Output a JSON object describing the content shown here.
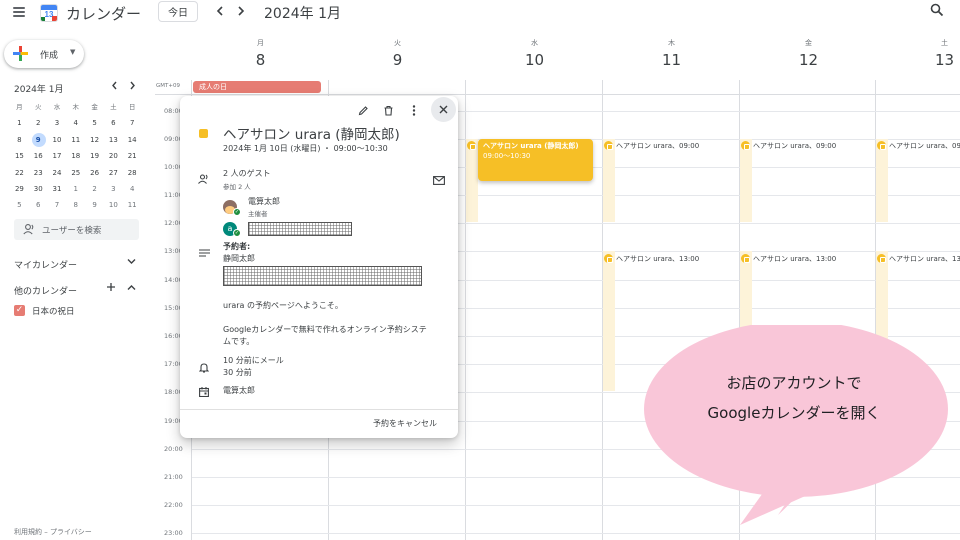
{
  "header": {
    "app_title": "カレンダー",
    "logo_number": "13",
    "today_label": "今日",
    "prev_icon": "chevron-left-icon",
    "next_icon": "chevron-right-icon",
    "month_title": "2024年 1月",
    "search_icon": "search-icon"
  },
  "sidebar": {
    "create_label": "作成",
    "mini_calendar": {
      "title": "2024年 1月",
      "weekdays": [
        "月",
        "火",
        "水",
        "木",
        "金",
        "土",
        "日"
      ],
      "weeks": [
        [
          "1",
          "2",
          "3",
          "4",
          "5",
          "6",
          "7"
        ],
        [
          "8",
          "9",
          "10",
          "11",
          "12",
          "13",
          "14"
        ],
        [
          "15",
          "16",
          "17",
          "18",
          "19",
          "20",
          "21"
        ],
        [
          "22",
          "23",
          "24",
          "25",
          "26",
          "27",
          "28"
        ],
        [
          "29",
          "30",
          "31",
          "1",
          "2",
          "3",
          "4"
        ],
        [
          "5",
          "6",
          "7",
          "8",
          "9",
          "10",
          "11"
        ]
      ],
      "selected_day": "9"
    },
    "user_search_placeholder": "ユーザーを検索",
    "my_calendars_label": "マイカレンダー",
    "other_calendars_label": "他のカレンダー",
    "other_calendar_item": "日本の祝日",
    "holiday_color": "#e67c73",
    "footer": "利用規約 – プライバシー"
  },
  "grid": {
    "timezone": "GMT+09",
    "days": [
      {
        "dow": "月",
        "num": "8"
      },
      {
        "dow": "火",
        "num": "9"
      },
      {
        "dow": "水",
        "num": "10"
      },
      {
        "dow": "木",
        "num": "11"
      },
      {
        "dow": "金",
        "num": "12"
      },
      {
        "dow": "土",
        "num": "13"
      }
    ],
    "hours": [
      "08:00",
      "09:00",
      "10:00",
      "11:00",
      "12:00",
      "13:00",
      "14:00",
      "15:00",
      "16:00",
      "17:00",
      "18:00",
      "19:00",
      "20:00",
      "21:00",
      "22:00",
      "23:00"
    ],
    "holiday_event": "成人の日",
    "selected_event": {
      "title": "ヘアサロン urara (静岡太郎)",
      "time": "09:00～10:30"
    },
    "event_chips": [
      {
        "text": "ヘアサロン urara、09:00"
      },
      {
        "text": "ヘアサロン urara、09:00"
      },
      {
        "text": "ヘアサロン urara、09:00"
      },
      {
        "text": "ヘアサロン urara、13:00"
      },
      {
        "text": "ヘアサロン urara、13:00"
      },
      {
        "text": "ヘアサロン urara、13:00"
      }
    ],
    "event_color": "#f6bf26"
  },
  "popup": {
    "edit_icon": "pencil-icon",
    "delete_icon": "trash-icon",
    "more_icon": "more-vert-icon",
    "close_icon": "close-icon",
    "title": "ヘアサロン urara (静岡太郎)",
    "date_line": "2024年 1月 10日 (水曜日) ・ 09:00～10:30",
    "guests_title": "2 人のゲスト",
    "guests_sub": "参加 2 人",
    "organizer_name": "電算太郎",
    "organizer_role": "主催者",
    "guest2_avatar_letter": "a",
    "booker_label": "予約者:",
    "booker_name": "静岡太郎",
    "description_line1": "urara の予約ページへようこそ。",
    "description_line2": "Googleカレンダーで無料で作れるオンライン予約システ",
    "description_line3": "ムです。",
    "reminder1": "10 分前にメール",
    "reminder2": "30 分前",
    "calendar_owner": "電算太郎",
    "cancel_label": "予約をキャンセル"
  },
  "callout": {
    "line1": "お店のアカウントで",
    "line2": "Googleカレンダーを開く",
    "color": "#f9c6d8"
  }
}
